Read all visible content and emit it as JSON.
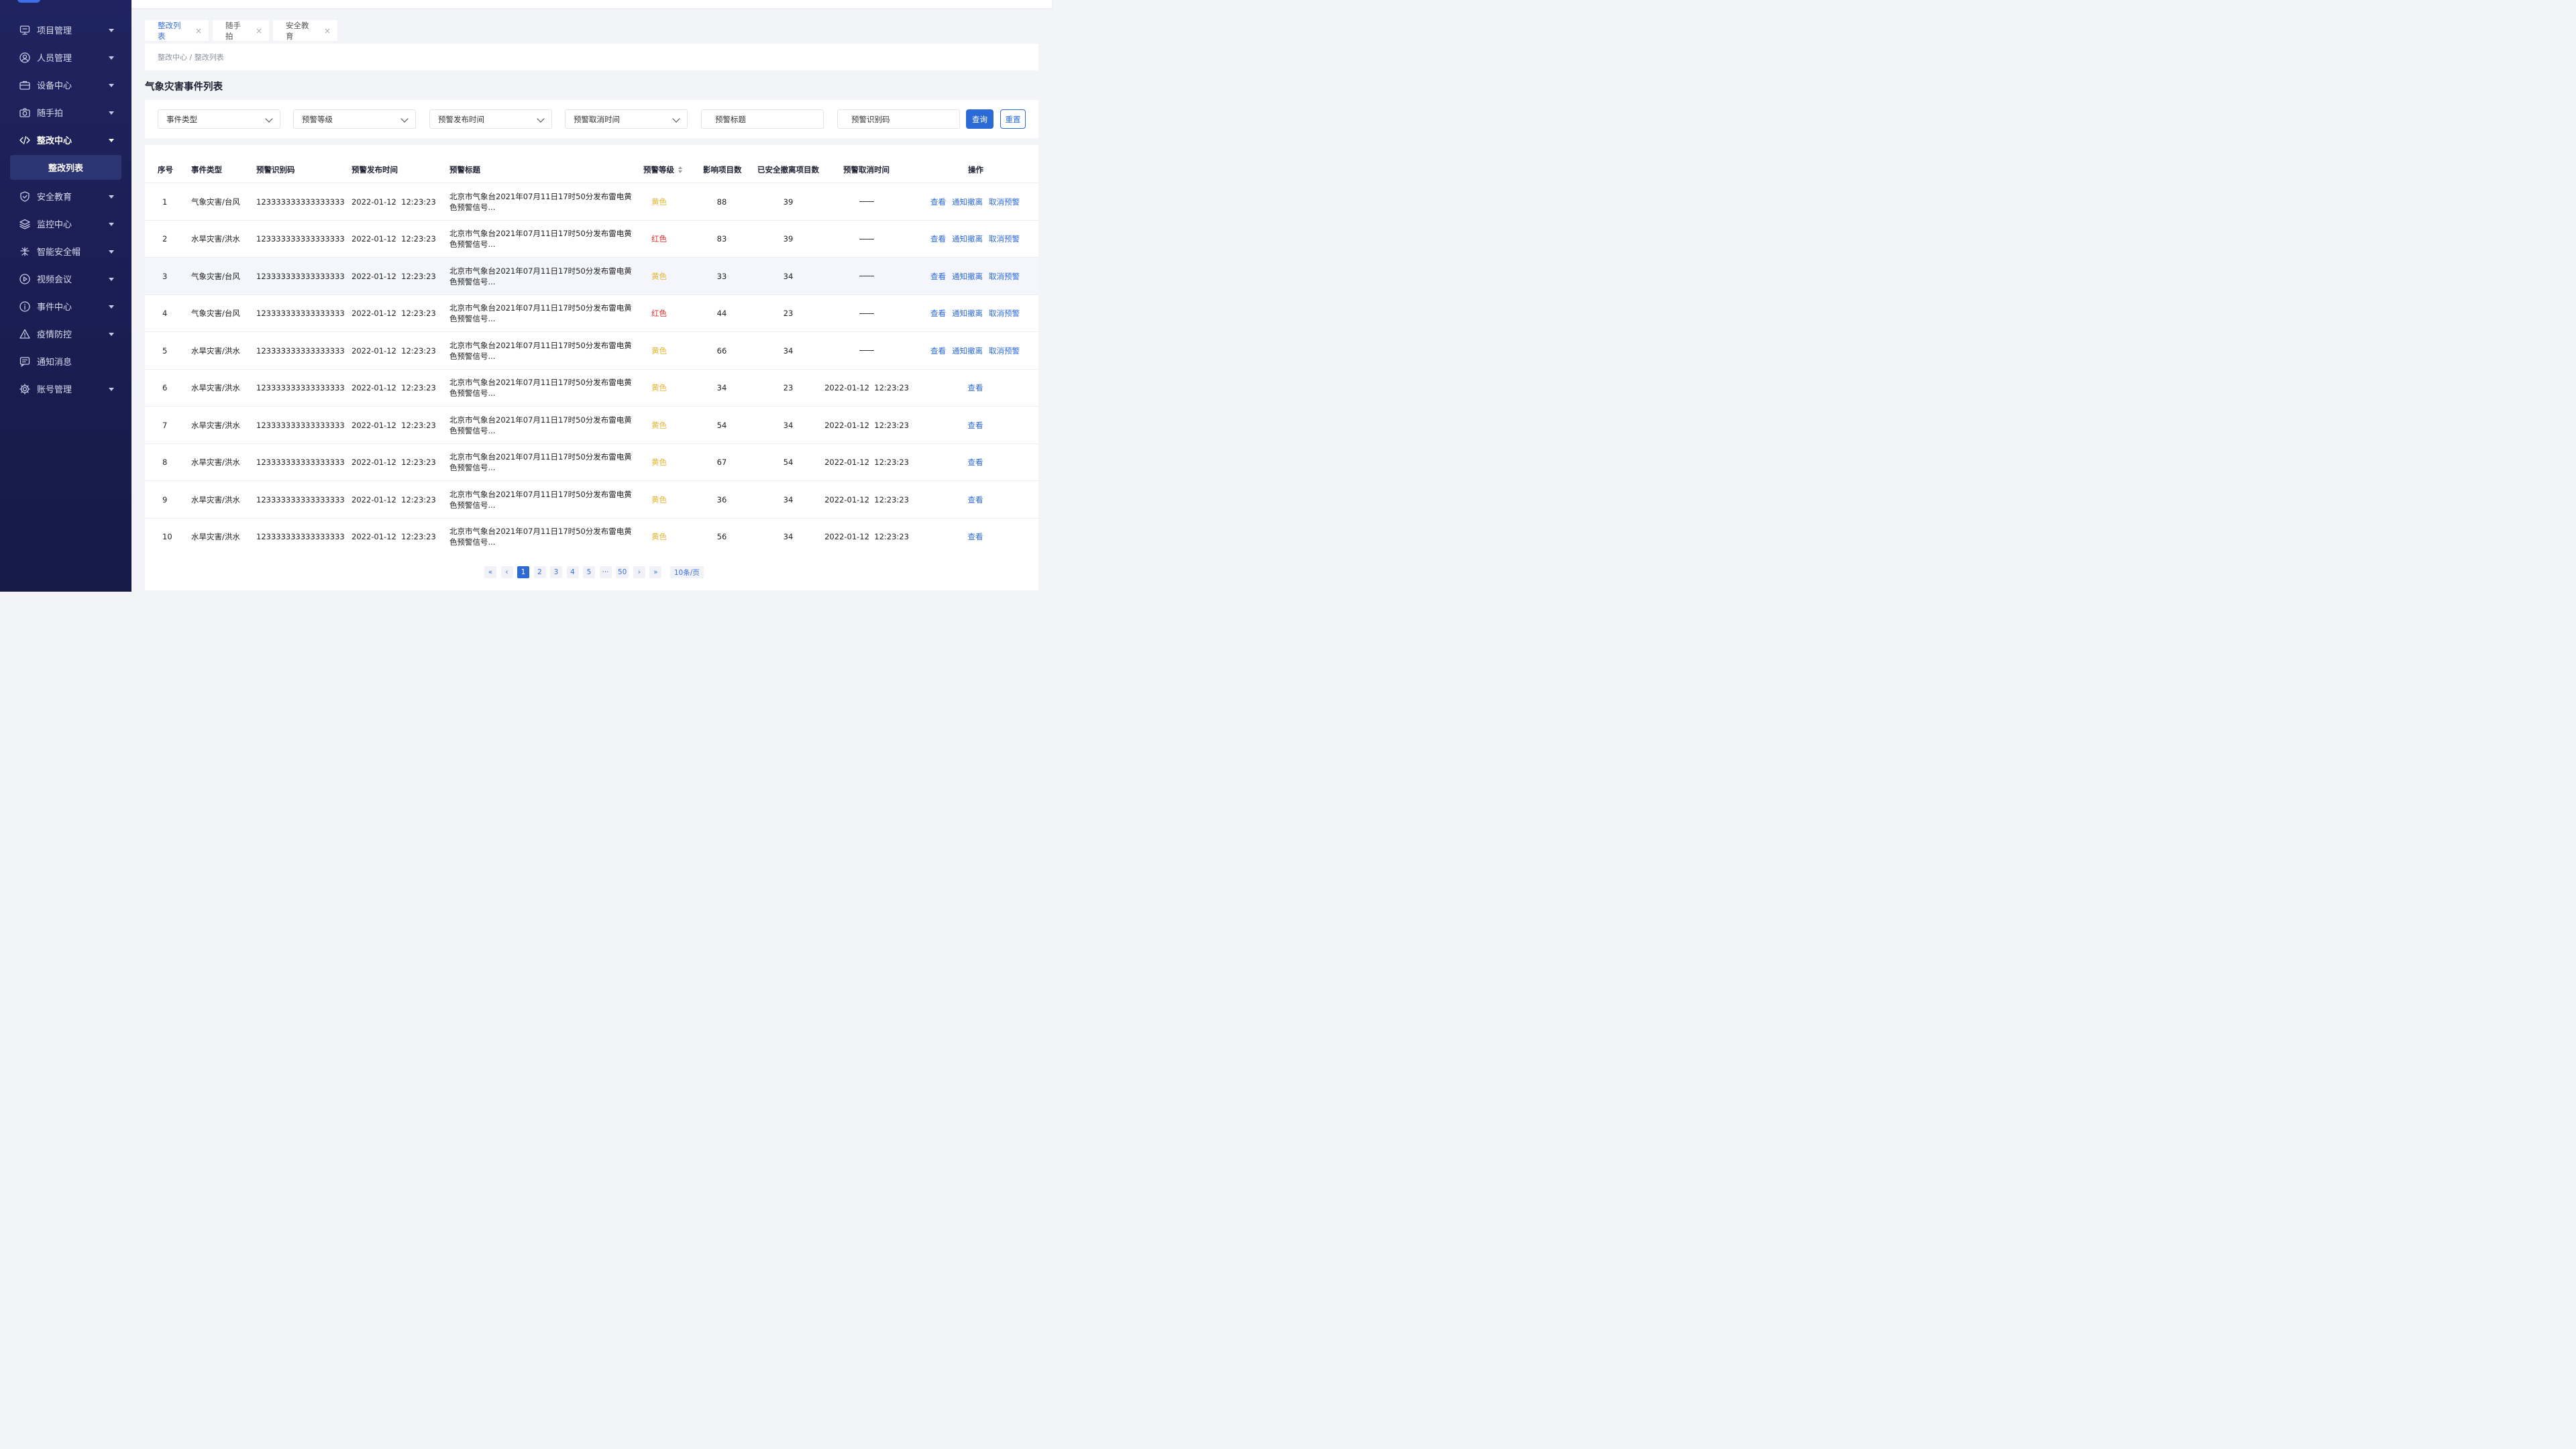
{
  "sidebar": {
    "items": [
      {
        "label": "项目管理",
        "icon": "monitor-icon",
        "caret": true
      },
      {
        "label": "人员管理",
        "icon": "user-circle-icon",
        "caret": true
      },
      {
        "label": "设备中心",
        "icon": "briefcase-icon",
        "caret": true
      },
      {
        "label": "随手拍",
        "icon": "camera-icon",
        "caret": true
      },
      {
        "label": "整改中心",
        "icon": "code-icon",
        "caret": true,
        "active": true
      },
      {
        "label": "安全教育",
        "icon": "shield-icon",
        "caret": true
      },
      {
        "label": "监控中心",
        "icon": "layers-icon",
        "caret": true
      },
      {
        "label": "智能安全帽",
        "icon": "helmet-icon",
        "caret": true
      },
      {
        "label": "视频会议",
        "icon": "play-circle-icon",
        "caret": true
      },
      {
        "label": "事件中心",
        "icon": "info-circle-icon",
        "caret": true
      },
      {
        "label": "疫情防控",
        "icon": "warning-icon",
        "caret": true
      },
      {
        "label": "通知消息",
        "icon": "message-icon",
        "caret": false
      },
      {
        "label": "账号管理",
        "icon": "gear-icon",
        "caret": true
      }
    ],
    "active_sub": "整改列表"
  },
  "tabs": [
    {
      "label": "整改列表",
      "active": true
    },
    {
      "label": "随手拍",
      "active": false
    },
    {
      "label": "安全教育",
      "active": false
    }
  ],
  "breadcrumb": "整改中心 / 整改列表",
  "page_title": "气象灾害事件列表",
  "filters": {
    "event_type": "事件类型",
    "level": "预警等级",
    "publish_time": "预警发布时间",
    "cancel_time": "预警取消时间",
    "title_placeholder": "预警标题",
    "code_placeholder": "预警识别码",
    "query_label": "查询",
    "reset_label": "重置"
  },
  "table": {
    "headers": {
      "no": "序号",
      "type": "事件类型",
      "code": "预警识别码",
      "time": "预警发布时间",
      "title": "预警标题",
      "level": "预警等级",
      "impact": "影响项目数",
      "safe": "已安全撤离项目数",
      "cancel": "预警取消时间",
      "ops": "操作"
    },
    "ops_labels": {
      "view": "查看",
      "notify": "通知撤离",
      "cancel": "取消预警"
    },
    "rows": [
      {
        "no": "1",
        "type": "气象灾害/台风",
        "code": "123333333333333333",
        "time": "2022-01-12  12:23:23",
        "title": "北京市气象台2021年07月11日17时50分发布雷电黄色预警信号...",
        "level": "黄色",
        "level_color": "yellow",
        "impact": "88",
        "safe": "39",
        "cancel": "",
        "ops": 3
      },
      {
        "no": "2",
        "type": "水旱灾害/洪水",
        "code": "123333333333333333",
        "time": "2022-01-12  12:23:23",
        "title": "北京市气象台2021年07月11日17时50分发布雷电黄色预警信号...",
        "level": "红色",
        "level_color": "red",
        "impact": "83",
        "safe": "39",
        "cancel": "",
        "ops": 3
      },
      {
        "no": "3",
        "type": "气象灾害/台风",
        "code": "123333333333333333",
        "time": "2022-01-12  12:23:23",
        "title": "北京市气象台2021年07月11日17时50分发布雷电黄色预警信号...",
        "level": "黄色",
        "level_color": "yellow",
        "impact": "33",
        "safe": "34",
        "cancel": "",
        "ops": 3
      },
      {
        "no": "4",
        "type": "气象灾害/台风",
        "code": "123333333333333333",
        "time": "2022-01-12  12:23:23",
        "title": "北京市气象台2021年07月11日17时50分发布雷电黄色预警信号...",
        "level": "红色",
        "level_color": "red",
        "impact": "44",
        "safe": "23",
        "cancel": "",
        "ops": 3
      },
      {
        "no": "5",
        "type": "水旱灾害/洪水",
        "code": "123333333333333333",
        "time": "2022-01-12  12:23:23",
        "title": "北京市气象台2021年07月11日17时50分发布雷电黄色预警信号...",
        "level": "黄色",
        "level_color": "yellow",
        "impact": "66",
        "safe": "34",
        "cancel": "",
        "ops": 3
      },
      {
        "no": "6",
        "type": "水旱灾害/洪水",
        "code": "123333333333333333",
        "time": "2022-01-12  12:23:23",
        "title": "北京市气象台2021年07月11日17时50分发布雷电黄色预警信号...",
        "level": "黄色",
        "level_color": "yellow",
        "impact": "34",
        "safe": "23",
        "cancel": "2022-01-12  12:23:23",
        "ops": 1
      },
      {
        "no": "7",
        "type": "水旱灾害/洪水",
        "code": "123333333333333333",
        "time": "2022-01-12  12:23:23",
        "title": "北京市气象台2021年07月11日17时50分发布雷电黄色预警信号...",
        "level": "黄色",
        "level_color": "yellow",
        "impact": "54",
        "safe": "34",
        "cancel": "2022-01-12  12:23:23",
        "ops": 1
      },
      {
        "no": "8",
        "type": "水旱灾害/洪水",
        "code": "123333333333333333",
        "time": "2022-01-12  12:23:23",
        "title": "北京市气象台2021年07月11日17时50分发布雷电黄色预警信号...",
        "level": "黄色",
        "level_color": "yellow",
        "impact": "67",
        "safe": "54",
        "cancel": "2022-01-12  12:23:23",
        "ops": 1
      },
      {
        "no": "9",
        "type": "水旱灾害/洪水",
        "code": "123333333333333333",
        "time": "2022-01-12  12:23:23",
        "title": "北京市气象台2021年07月11日17时50分发布雷电黄色预警信号...",
        "level": "黄色",
        "level_color": "yellow",
        "impact": "36",
        "safe": "34",
        "cancel": "2022-01-12  12:23:23",
        "ops": 1
      },
      {
        "no": "10",
        "type": "水旱灾害/洪水",
        "code": "123333333333333333",
        "time": "2022-01-12  12:23:23",
        "title": "北京市气象台2021年07月11日17时50分发布雷电黄色预警信号...",
        "level": "黄色",
        "level_color": "yellow",
        "impact": "56",
        "safe": "34",
        "cancel": "2022-01-12  12:23:23",
        "ops": 1
      }
    ]
  },
  "pagination": {
    "first": "«",
    "prev": "‹",
    "pages": [
      "1",
      "2",
      "3",
      "4",
      "5"
    ],
    "ellipsis": "···",
    "last_page": "50",
    "next": "›",
    "last": "»",
    "current": "1",
    "page_size": "10条/页"
  },
  "colors": {
    "accent": "#2c6ad8",
    "yellow": "#e5b631",
    "red": "#d9302c",
    "sidebar": "#1f2460"
  }
}
